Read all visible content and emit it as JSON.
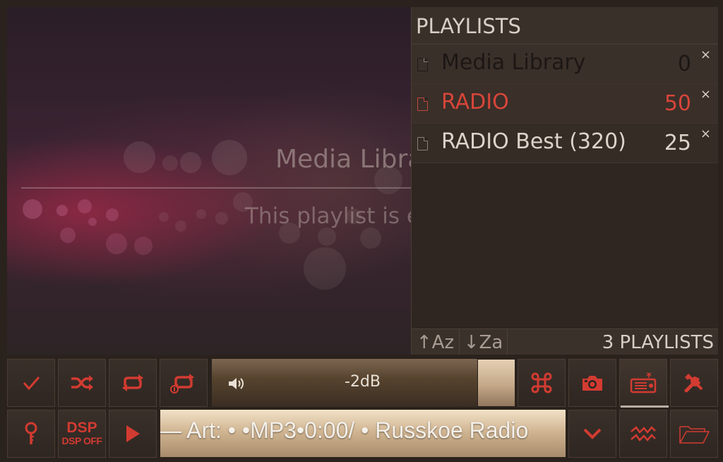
{
  "main": {
    "empty_title": "Media Library",
    "empty_message": "This playlist is empty"
  },
  "playlists_panel": {
    "title": "PLAYLISTS",
    "items": [
      {
        "name": "Media Library",
        "count": "0",
        "state": "dim"
      },
      {
        "name": "RADIO",
        "count": "50",
        "state": "active"
      },
      {
        "name": "RADIO Best (320)",
        "count": "25",
        "state": "normal"
      }
    ],
    "close_glyph": "×",
    "sort_asc_label": "↑Az",
    "sort_desc_label": "↓Za",
    "footer_count": "3 PLAYLISTS"
  },
  "controls": {
    "volume_label": "-2dB",
    "volume_level": 0.88,
    "dsp_label": "DSP",
    "dsp_state": "DSP OFF",
    "now_playing": "— Art: • •MP3•0:00/ • Russkoe Radio",
    "icons": {
      "check": "check-icon",
      "shuffle": "shuffle-icon",
      "repeat": "repeat-icon",
      "repeat_one": "repeat-one-icon",
      "command": "command-icon",
      "camera": "camera-icon",
      "radio": "radio-icon",
      "settings": "tools-icon",
      "search": "search-icon",
      "play": "play-icon",
      "chevron": "chevron-down-icon",
      "equalizer": "equalizer-icon",
      "folder": "folder-icon"
    }
  },
  "colors": {
    "accent_red": "#d23b31",
    "panel_bg": "#2f2621",
    "text_light": "#ddd3c9"
  }
}
